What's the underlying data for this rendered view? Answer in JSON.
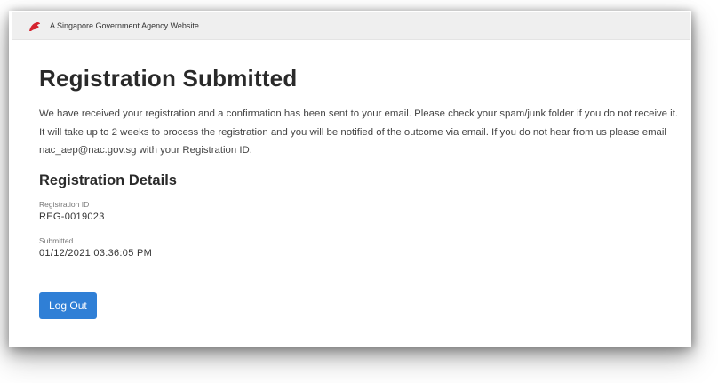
{
  "masthead": {
    "text": "A Singapore Government Agency Website",
    "icon": "singapore-lion-icon",
    "icon_color": "#d5232f"
  },
  "page": {
    "title": "Registration Submitted",
    "message": "We have received your registration and a confirmation has been sent to your email. Please check your spam/junk folder if you do not receive it. It will take up to 2 weeks to process the registration and you will be notified of the outcome via email. If you do not hear from us please email nac_aep@nac.gov.sg with your Registration ID."
  },
  "details": {
    "title": "Registration Details",
    "registration_id_label": "Registration ID",
    "registration_id_value": "REG-0019023",
    "submitted_label": "Submitted",
    "submitted_value": "01/12/2021 03:36:05 PM"
  },
  "actions": {
    "logout_label": "Log Out",
    "button_color": "#2f7fd6"
  }
}
